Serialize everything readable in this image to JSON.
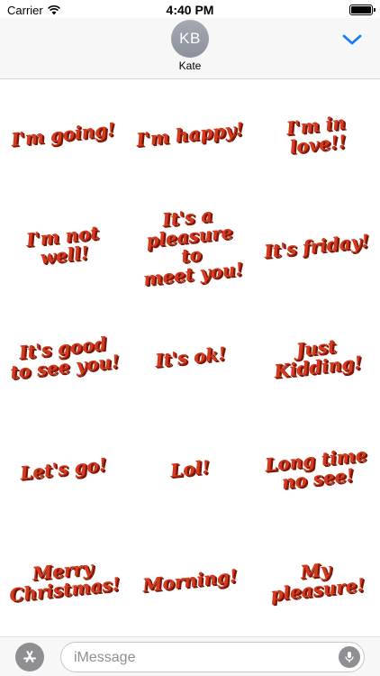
{
  "status_bar": {
    "carrier": "Carrier",
    "time": "4:40 PM"
  },
  "header": {
    "avatar_initials": "KB",
    "contact_name": "Kate",
    "accent_color": "#1a7cf5"
  },
  "stickers": [
    "I'm going!",
    "I'm happy!",
    "I'm in\nlove!!",
    "I'm not\nwell!",
    "It's a\npleasure to\nmeet you!",
    "It's friday!",
    "It's good\nto see you!",
    "It's ok!",
    "Just\nKidding!",
    "Let's go!",
    "Lol!",
    "Long time\nno see!",
    "Merry\nChristmas!",
    "Morning!",
    "My\npleasure!"
  ],
  "sticker_color": "#d63a1e",
  "input_bar": {
    "placeholder": "iMessage",
    "value": ""
  }
}
